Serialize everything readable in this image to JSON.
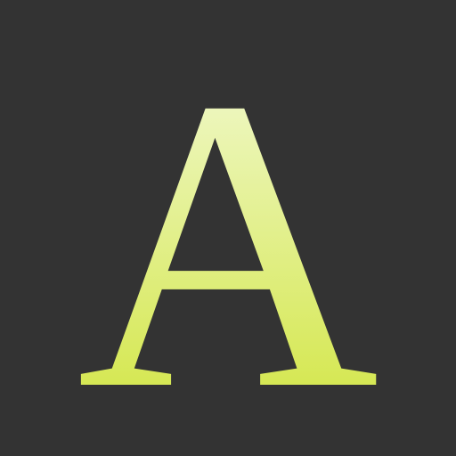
{
  "icon": {
    "letter": "A",
    "background_color": "#333333",
    "letter_gradient_top": "#EEF7C2",
    "letter_gradient_bottom": "#D6E855"
  }
}
